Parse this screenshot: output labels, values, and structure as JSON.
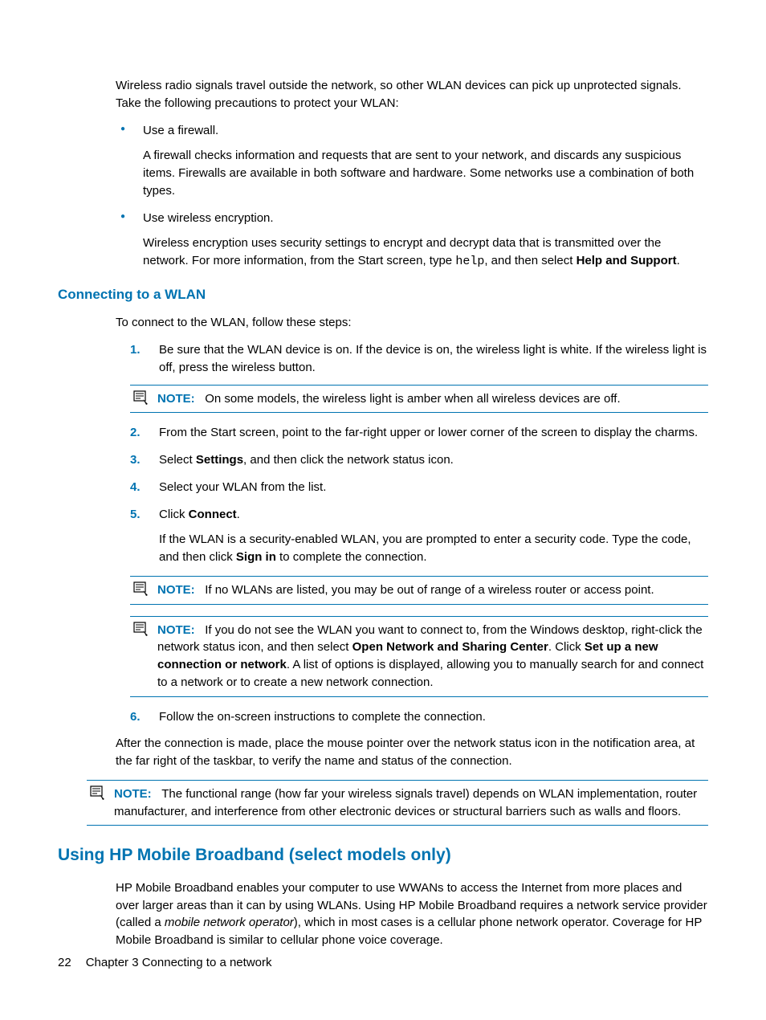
{
  "intro": {
    "p1": "Wireless radio signals travel outside the network, so other WLAN devices can pick up unprotected signals. Take the following precautions to protect your WLAN:",
    "bullets": [
      {
        "lead": "Use a firewall.",
        "sub": "A firewall checks information and requests that are sent to your network, and discards any suspicious items. Firewalls are available in both software and hardware. Some networks use a combination of both types."
      },
      {
        "lead": "Use wireless encryption.",
        "sub_before": "Wireless encryption uses security settings to encrypt and decrypt data that is transmitted over the network. For more information, from the Start screen, type ",
        "sub_code": "help",
        "sub_mid": ", and then select ",
        "sub_bold": "Help and Support",
        "sub_after": "."
      }
    ]
  },
  "section1": {
    "title": "Connecting to a WLAN",
    "intro": "To connect to the WLAN, follow these steps:",
    "steps": {
      "s1": "Be sure that the WLAN device is on. If the device is on, the wireless light is white. If the wireless light is off, press the wireless button.",
      "note1": {
        "label": "NOTE:",
        "text": "On some models, the wireless light is amber when all wireless devices are off."
      },
      "s2": "From the Start screen, point to the far-right upper or lower corner of the screen to display the charms.",
      "s3_a": "Select ",
      "s3_b": "Settings",
      "s3_c": ", and then click the network status icon.",
      "s4": "Select your WLAN from the list.",
      "s5_a": "Click ",
      "s5_b": "Connect",
      "s5_c": ".",
      "s5_sub_a": "If the WLAN is a security-enabled WLAN, you are prompted to enter a security code. Type the code, and then click ",
      "s5_sub_b": "Sign in",
      "s5_sub_c": " to complete the connection.",
      "note2": {
        "label": "NOTE:",
        "text": "If no WLANs are listed, you may be out of range of a wireless router or access point."
      },
      "note3": {
        "label": "NOTE:",
        "t1": "If you do not see the WLAN you want to connect to, from the Windows desktop, right-click the network status icon, and then select ",
        "b1": "Open Network and Sharing Center",
        "t2": ". Click ",
        "b2": "Set up a new connection or network",
        "t3": ". A list of options is displayed, allowing you to manually search for and connect to a network or to create a new network connection."
      },
      "s6": "Follow the on-screen instructions to complete the connection."
    },
    "after": "After the connection is made, place the mouse pointer over the network status icon in the notification area, at the far right of the taskbar, to verify the name and status of the connection.",
    "note4": {
      "label": "NOTE:",
      "text": "The functional range (how far your wireless signals travel) depends on WLAN implementation, router manufacturer, and interference from other electronic devices or structural barriers such as walls and floors."
    }
  },
  "section2": {
    "title": "Using HP Mobile Broadband (select models only)",
    "p1_a": "HP Mobile Broadband enables your computer to use WWANs to access the Internet from more places and over larger areas than it can by using WLANs. Using HP Mobile Broadband requires a network service provider (called a ",
    "p1_i": "mobile network operator",
    "p1_b": "), which in most cases is a cellular phone network operator. Coverage for HP Mobile Broadband is similar to cellular phone voice coverage."
  },
  "footer": {
    "page": "22",
    "chapter": "Chapter 3   Connecting to a network"
  }
}
